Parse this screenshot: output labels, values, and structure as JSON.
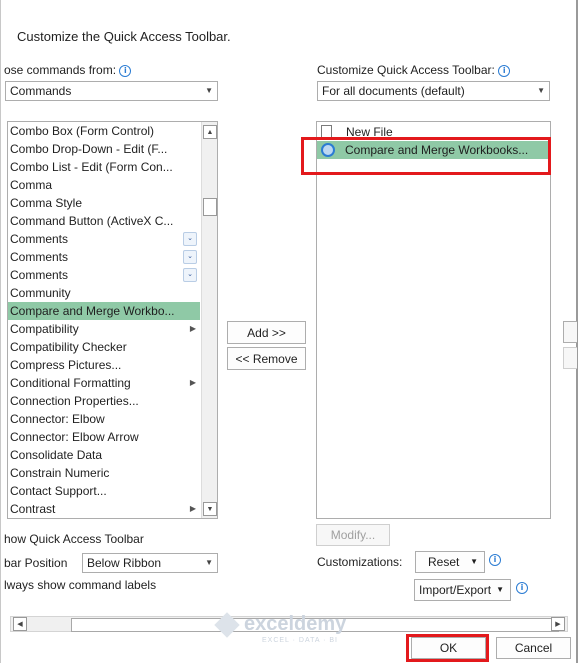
{
  "dialog": {
    "heading": "Customize the Quick Access Toolbar."
  },
  "left": {
    "choose_label": "ose commands from:",
    "choose_value": "Commands",
    "commands": [
      {
        "label": "Combo Box (Form Control)"
      },
      {
        "label": "Combo Drop-Down - Edit (F..."
      },
      {
        "label": "Combo List - Edit (Form Con..."
      },
      {
        "label": "Comma"
      },
      {
        "label": "Comma Style"
      },
      {
        "label": "Command Button (ActiveX C..."
      },
      {
        "label": "Comments"
      },
      {
        "label": "Comments"
      },
      {
        "label": "Comments"
      },
      {
        "label": "Community"
      },
      {
        "label": "Compare and Merge Workbo..."
      },
      {
        "label": "Compatibility"
      },
      {
        "label": "Compatibility Checker"
      },
      {
        "label": "Compress Pictures..."
      },
      {
        "label": "Conditional Formatting"
      },
      {
        "label": "Connection Properties..."
      },
      {
        "label": "Connector: Elbow"
      },
      {
        "label": "Connector: Elbow Arrow"
      },
      {
        "label": "Consolidate Data"
      },
      {
        "label": "Constrain Numeric"
      },
      {
        "label": "Contact Support..."
      },
      {
        "label": "Contrast"
      }
    ],
    "show_qat_label": "how Quick Access Toolbar",
    "toolbar_position_label": "bar Position",
    "toolbar_position_value": "Below Ribbon",
    "always_show_labels": "lways show command labels"
  },
  "middle": {
    "add_label": "Add >>",
    "remove_label": "<< Remove"
  },
  "right": {
    "customize_label": "Customize Quick Access Toolbar:",
    "scope_value": "For all documents (default)",
    "items": [
      {
        "label": "New File"
      },
      {
        "label": "Compare and Merge Workbooks..."
      }
    ],
    "modify_label": "Modify...",
    "customizations_label": "Customizations:",
    "reset_label": "Reset",
    "import_export_label": "Import/Export"
  },
  "footer": {
    "ok_label": "OK",
    "cancel_label": "Cancel"
  },
  "watermark": {
    "brand": "exceldemy",
    "tagline": "EXCEL · DATA · BI"
  },
  "colors": {
    "selection": "#8fc9a6",
    "highlight_box": "#e3191c",
    "info_icon": "#2b7cd3"
  }
}
